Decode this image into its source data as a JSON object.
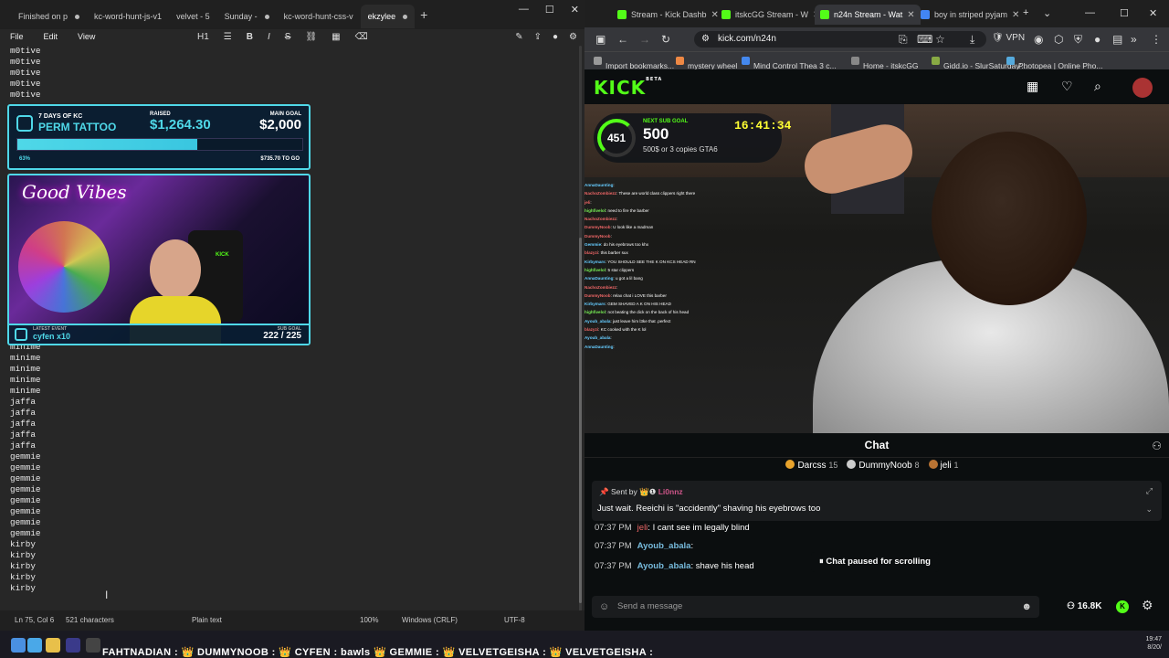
{
  "notepad": {
    "tabs": [
      {
        "label": "Finished on p",
        "dirty": true
      },
      {
        "label": "kc-word-hunt-js-v1",
        "dirty": false
      },
      {
        "label": "velvet - 5",
        "dirty": false
      },
      {
        "label": "Sunday -",
        "dirty": true
      },
      {
        "label": "kc-word-hunt-css-v",
        "dirty": false
      },
      {
        "label": "ekzylee",
        "dirty": true
      }
    ],
    "menu": [
      "File",
      "Edit",
      "View"
    ],
    "heading_btn": "H1",
    "lines_top": [
      "m0tive",
      "m0tive",
      "m0tive",
      "m0tive",
      "m0tive"
    ],
    "lines_bottom": [
      "minime",
      "minime",
      "minime",
      "minime",
      "minime",
      "jaffa",
      "jaffa",
      "jaffa",
      "jaffa",
      "jaffa",
      "gemmie",
      "gemmie",
      "gemmie",
      "gemmie",
      "gemmie",
      "gemmie",
      "gemmie",
      "gemmie",
      "kirby",
      "kirby",
      "kirby",
      "kirby",
      "kirby"
    ],
    "status": {
      "position": "Ln 75, Col 6",
      "chars": "521 characters",
      "format": "Plain text",
      "zoom": "100%",
      "eol": "Windows (CRLF)",
      "encoding": "UTF-8"
    }
  },
  "overlay": {
    "goal_title_small": "7 DAYS OF KC",
    "goal_title": "PERM TATTOO",
    "raised_label": "RAISED",
    "raised_value": "$1,264.30",
    "main_goal_label": "MAIN GOAL",
    "main_goal_value": "$2,000",
    "progress": 0.63,
    "progress_text": "63%",
    "to_go": "$735.70 TO GO",
    "cam_text": "Good Vibes",
    "cam_logo": "KICK",
    "latest_event_label": "LATEST EVENT",
    "latest_event": "cyfen x10",
    "sub_goal_label": "SUB GOAL",
    "sub_goal_value": "222 / 225"
  },
  "browser": {
    "tabs": [
      {
        "label": "Stream - Kick Dashb",
        "color": "#53fc18"
      },
      {
        "label": "itskcGG Stream - W",
        "color": "#53fc18"
      },
      {
        "label": "n24n Stream - Wat",
        "color": "#53fc18",
        "active": true
      },
      {
        "label": "boy in striped pyjam",
        "color": "#4285f4"
      }
    ],
    "url": "kick.com/n24n",
    "vpn": "VPN",
    "bookmarks": [
      {
        "label": "Import bookmarks...",
        "color": "#999"
      },
      {
        "label": "mystery wheel",
        "color": "#e84"
      },
      {
        "label": "Mind Control Thea 3 c...",
        "color": "#48e"
      },
      {
        "label": "Home - itskcGG",
        "color": "#888"
      },
      {
        "label": "Gidd.io - SlurSaturday'...",
        "color": "#8a4"
      },
      {
        "label": "Photopea | Online Pho...",
        "color": "#5ad"
      }
    ]
  },
  "kick": {
    "logo": "KICK",
    "beta": "BETA",
    "subgoal": {
      "count": "451",
      "label": "NEXT SUB GOAL",
      "value": "500",
      "desc": "500$ or 3 copies GTA6",
      "timer": "16:41:34"
    },
    "video_chat": [
      {
        "u": "AnnaDaunting",
        "m": "",
        "c": "u2"
      },
      {
        "u": "NachoZombiezz",
        "m": "These are world class clippers right there",
        "c": "u"
      },
      {
        "u": "jeli",
        "m": "",
        "c": "u"
      },
      {
        "u": "highfivelol",
        "m": "need to fire the barber",
        "c": "u3"
      },
      {
        "u": "NachoZombiezz",
        "m": "",
        "c": "u"
      },
      {
        "u": "DummyNoob",
        "m": "U look like a madman",
        "c": "u"
      },
      {
        "u": "DummyNoob",
        "m": "",
        "c": "u"
      },
      {
        "u": "Gemmie",
        "m": "do his eyebrows too khx",
        "c": "u2"
      },
      {
        "u": "blazyzi",
        "m": "this barber sux",
        "c": "u"
      },
      {
        "u": "Kirbymars",
        "m": "YOU SHOULD SEE THE K ON KCS HEAD RN",
        "c": "u2"
      },
      {
        "u": "highfivelol",
        "m": "5 star clippers",
        "c": "u3"
      },
      {
        "u": "AnnaDaunting",
        "m": "u got a lil bang",
        "c": "u2"
      },
      {
        "u": "NachoZombiezz",
        "m": "",
        "c": "u"
      },
      {
        "u": "DummyNoob",
        "m": "relax chat i LOVE this barber",
        "c": "u"
      },
      {
        "u": "Kirbymars",
        "m": "GEM SHAVED A K ON HIS HEAD",
        "c": "u2"
      },
      {
        "u": "highfivelol",
        "m": "not beating the dick on the back of his head",
        "c": "u3"
      },
      {
        "u": "Ayoub_abala",
        "m": "just leave him l3ke that .perfect",
        "c": "u2"
      },
      {
        "u": "blazyzi",
        "m": "KC cooked with the K lol",
        "c": "u"
      },
      {
        "u": "Ayoub_abala",
        "m": "",
        "c": "u2"
      },
      {
        "u": "AnnaDaunting",
        "m": "",
        "c": "u2"
      }
    ],
    "chat": {
      "title": "Chat",
      "gifters": [
        {
          "name": "Darcss",
          "count": "15",
          "color": "#e8a32c"
        },
        {
          "name": "DummyNoob",
          "count": "8",
          "color": "#ccc"
        },
        {
          "name": "jeli",
          "count": "1",
          "color": "#b87333"
        }
      ],
      "pinned_by_label": "Sent by",
      "pinned_by": "Li0nnz",
      "pinned_msg": "Just wait. Reeichi is \"accidently\" shaving his eyebrows too",
      "messages": [
        {
          "t": "07:37 PM",
          "u": "jeli",
          "m": "I cant see im legally blind",
          "cls": "nm2"
        },
        {
          "t": "07:37 PM",
          "u": "Ayoub_abala",
          "m": "",
          "cls": "nm"
        },
        {
          "t": "07:37 PM",
          "u": "Ayoub_abala",
          "m": "shave his head",
          "cls": "nm"
        }
      ],
      "paused": "Chat paused for scrolling",
      "send_placeholder": "Send a message",
      "viewers": "16.8K"
    }
  },
  "taskbar": {
    "ticker": "FAHTNADIAN : 👑 DUMMYNOOB : 👑 CYFEN : bawls 👑 GEMMIE : 👑 VELVETGEISHA : 👑 VELVETGEISHA :",
    "time": "19:47",
    "date": "8/20/"
  }
}
